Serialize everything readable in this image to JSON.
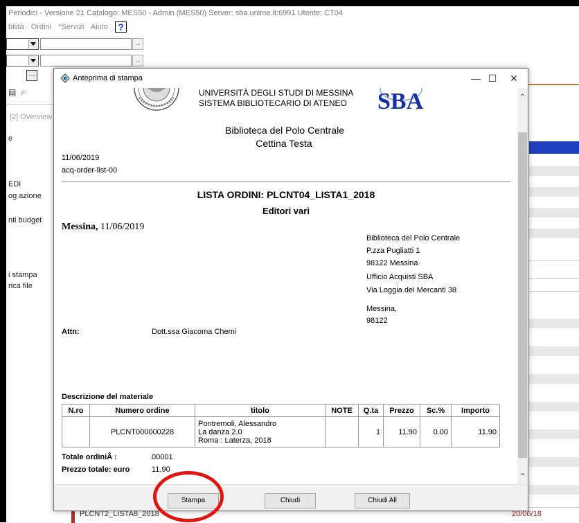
{
  "app": {
    "title": "Periodici - Versione 21 Catalogo: MES50 - Admin (MES50) Server: sba.unime.it:6991 Utente: CT04",
    "menu": [
      "bilità",
      "Ordini",
      "*Servizi",
      "Aiuto"
    ],
    "help_label": "?",
    "overview_tab": "[2] Overview",
    "left_items": [
      "e",
      "EDI",
      "og azione",
      "nti budget",
      "i stampa",
      "rica file"
    ],
    "bottom_row": {
      "name": "PLCNT2_LISTA8_2018",
      "date": "20/06/18"
    }
  },
  "dialog": {
    "title": "Anteprima di stampa",
    "minimize": "—",
    "maximize": "☐",
    "close": "✕",
    "buttons": {
      "stampa": "Stampa",
      "chiudi": "Chiudi",
      "chiudi_all": "Chiudi All"
    }
  },
  "report": {
    "university": "UNIVERSITÀ DEGLI STUDI DI MESSINA",
    "system": "SISTEMA BIBLIOTECARIO DI ATENEO",
    "sba_logo_text": "SBA",
    "library": "Biblioteca del Polo Centrale",
    "person": "Cettina Testa",
    "date": "11/06/2019",
    "code": "acq-order-list-00",
    "list_title": "LISTA ORDINI: PLCNT04_LISTA1_2018",
    "publisher": "Editori vari",
    "place": "Messina,",
    "place_date": " 11/06/2019",
    "address": {
      "line1": "Biblioteca del Polo Centrale",
      "line2": "P.zza Pugliatti 1",
      "line3": "98122 Messina",
      "line4": "Ufficio Acquisti SBA",
      "line5": "Via Loggia dei Mercanti 38",
      "line6": "Messina,",
      "line7": "98122"
    },
    "attn_label": "Attn:",
    "attn_value": "Dott.ssa Giacoma Chemi",
    "desc_label": "Descrizione del materiale",
    "table": {
      "headers": [
        "N.ro",
        "Numero ordine",
        "titolo",
        "NOTE",
        "Q.ta",
        "Prezzo",
        "Sc.%",
        "Importo"
      ],
      "row": {
        "nro": "",
        "numero": "PLCNT000000228",
        "titolo_1": "Pontremoli, Alessandro",
        "titolo_2": "La danza 2.0",
        "titolo_3": "Roma : Laterza, 2018",
        "note": "",
        "qta": "1",
        "prezzo": "11.90",
        "sconto": "0.00",
        "importo": "11.90"
      }
    },
    "totale_label": "Totale ordiniÂ :",
    "totale_value": "00001",
    "prezzo_label": "Prezzo totale: euro",
    "prezzo_value": "11.90"
  },
  "colors": {
    "highlight_circle": "#e2140f",
    "selection_blue": "#1f3fbf"
  }
}
